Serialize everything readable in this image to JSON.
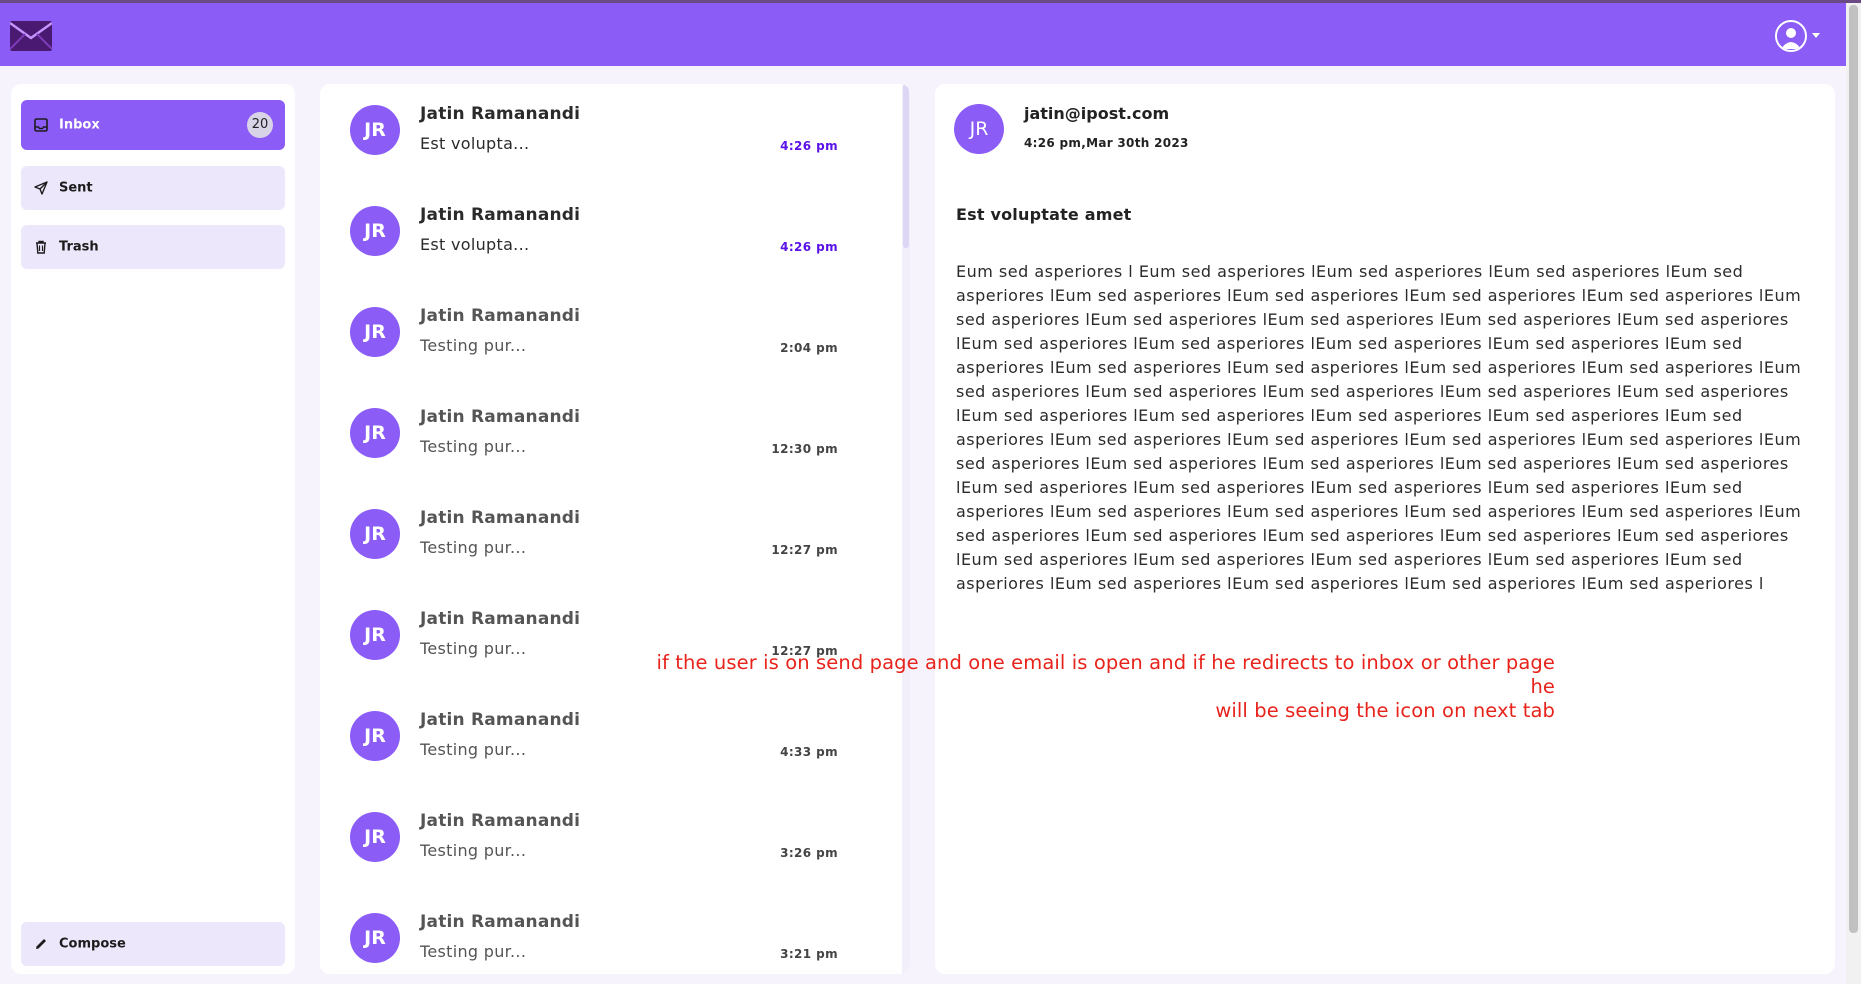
{
  "header": {
    "logo_icon": "envelope-icon",
    "profile_icon": "user-circle-icon",
    "brand_color": "#8b5cf6"
  },
  "sidebar": {
    "items": [
      {
        "label": "Inbox",
        "icon": "inbox-icon",
        "count": "20"
      },
      {
        "label": "Sent",
        "icon": "send-icon"
      },
      {
        "label": "Trash",
        "icon": "trash-icon"
      }
    ],
    "compose_label": "Compose",
    "compose_icon": "pencil-icon"
  },
  "mail_list": [
    {
      "initials": "JR",
      "sender": "Jatin Ramanandi",
      "subject": "Est volupta...",
      "time": "4:26 pm",
      "unread": true
    },
    {
      "initials": "JR",
      "sender": "Jatin Ramanandi",
      "subject": "Est volupta...",
      "time": "4:26 pm",
      "unread": true
    },
    {
      "initials": "JR",
      "sender": "Jatin Ramanandi",
      "subject": "Testing pur...",
      "time": "2:04 pm",
      "unread": false
    },
    {
      "initials": "JR",
      "sender": "Jatin Ramanandi",
      "subject": "Testing pur...",
      "time": "12:30 pm",
      "unread": false
    },
    {
      "initials": "JR",
      "sender": "Jatin Ramanandi",
      "subject": "Testing pur...",
      "time": "12:27 pm",
      "unread": false
    },
    {
      "initials": "JR",
      "sender": "Jatin Ramanandi",
      "subject": "Testing pur...",
      "time": "12:27 pm",
      "unread": false
    },
    {
      "initials": "JR",
      "sender": "Jatin Ramanandi",
      "subject": "Testing pur...",
      "time": "4:33 pm",
      "unread": false
    },
    {
      "initials": "JR",
      "sender": "Jatin Ramanandi",
      "subject": "Testing pur...",
      "time": "3:26 pm",
      "unread": false
    },
    {
      "initials": "JR",
      "sender": "Jatin Ramanandi",
      "subject": "Testing pur...",
      "time": "3:21 pm",
      "unread": false
    }
  ],
  "reader": {
    "initials": "JR",
    "from": "jatin@ipost.com",
    "date": "4:26 pm,Mar 30th 2023",
    "subject": "Est voluptate amet",
    "body": "Eum sed asperiores l Eum sed asperiores lEum sed asperiores lEum sed asperiores lEum sed asperiores lEum sed asperiores lEum sed asperiores lEum sed asperiores lEum sed asperiores lEum sed asperiores lEum sed asperiores lEum sed asperiores lEum sed asperiores lEum sed asperiores lEum sed asperiores lEum sed asperiores lEum sed asperiores lEum sed asperiores lEum sed asperiores lEum sed asperiores lEum sed asperiores lEum sed asperiores lEum sed asperiores lEum sed asperiores lEum sed asperiores lEum sed asperiores lEum sed asperiores lEum sed asperiores lEum sed asperiores lEum sed asperiores lEum sed asperiores lEum sed asperiores lEum sed asperiores lEum sed asperiores lEum sed asperiores lEum sed asperiores lEum sed asperiores lEum sed asperiores lEum sed asperiores lEum sed asperiores lEum sed asperiores lEum sed asperiores lEum sed asperiores lEum sed asperiores lEum sed asperiores lEum sed asperiores lEum sed asperiores lEum sed asperiores lEum sed asperiores lEum sed asperiores lEum sed asperiores lEum sed asperiores lEum sed asperiores lEum sed asperiores lEum sed asperiores lEum sed asperiores lEum sed asperiores lEum sed asperiores lEum sed asperiores lEum sed asperiores lEum sed asperiores lEum sed asperiores lEum sed asperiores lEum sed asperiores lEum sed asperiores l"
  },
  "annotation": {
    "line1": "if the user is on send page and one email is open and if he redirects to inbox or other page he",
    "line2": "will be seeing the icon on next tab",
    "color": "#e8231b"
  }
}
